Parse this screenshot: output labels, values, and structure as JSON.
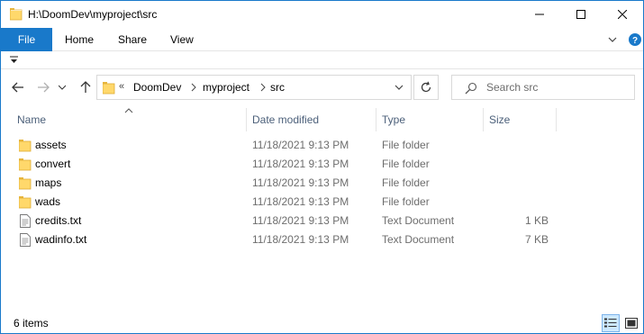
{
  "window": {
    "title": "H:\\DoomDev\\myproject\\src",
    "controls": [
      "minimize",
      "maximize",
      "close"
    ]
  },
  "ribbon": {
    "tabs": [
      {
        "label": "File",
        "active": true
      },
      {
        "label": "Home"
      },
      {
        "label": "Share"
      },
      {
        "label": "View"
      }
    ]
  },
  "address_bar": {
    "overflow_glyph": "«",
    "breadcrumbs": [
      "DoomDev",
      "myproject",
      "src"
    ]
  },
  "search": {
    "placeholder": "Search src"
  },
  "columns": [
    {
      "label": "Name",
      "sorted": "ascending"
    },
    {
      "label": "Date modified"
    },
    {
      "label": "Type"
    },
    {
      "label": "Size"
    }
  ],
  "files": [
    {
      "name": "assets",
      "date": "11/18/2021 9:13 PM",
      "type": "File folder",
      "size": "",
      "icon": "folder-icon"
    },
    {
      "name": "convert",
      "date": "11/18/2021 9:13 PM",
      "type": "File folder",
      "size": "",
      "icon": "folder-icon"
    },
    {
      "name": "maps",
      "date": "11/18/2021 9:13 PM",
      "type": "File folder",
      "size": "",
      "icon": "folder-icon"
    },
    {
      "name": "wads",
      "date": "11/18/2021 9:13 PM",
      "type": "File folder",
      "size": "",
      "icon": "folder-icon"
    },
    {
      "name": "credits.txt",
      "date": "11/18/2021 9:13 PM",
      "type": "Text Document",
      "size": "1 KB",
      "icon": "text-file-icon"
    },
    {
      "name": "wadinfo.txt",
      "date": "11/18/2021 9:13 PM",
      "type": "Text Document",
      "size": "7 KB",
      "icon": "text-file-icon"
    }
  ],
  "status": {
    "item_count": "6 items",
    "view_mode": "details"
  },
  "colors": {
    "accent": "#1979ca",
    "folder": "#ffd86b",
    "header_text": "#4c607a",
    "secondary_text": "#6d6d6d"
  }
}
